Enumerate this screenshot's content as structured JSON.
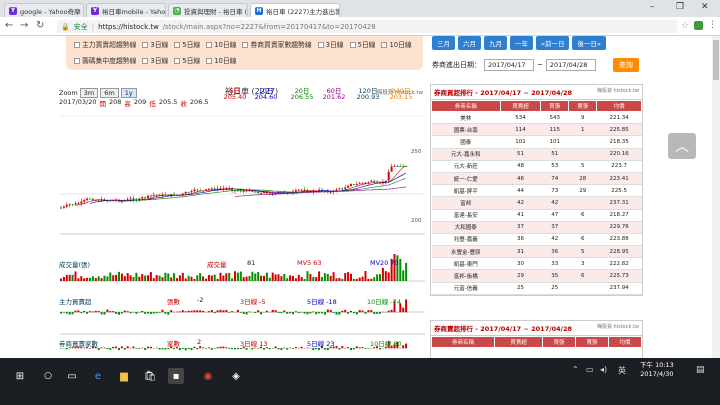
{
  "tabs": [
    {
      "label": "google - Yahoo奇摩 搜尋",
      "icon": "Y",
      "color": "#6e2bd9"
    },
    {
      "label": "裕日車mobile - Yahoo奇摩",
      "icon": "Y",
      "color": "#6e2bd9"
    },
    {
      "label": "投資與理財 - 裕日車 (郭...",
      "icon": "◔",
      "color": "#4caf50"
    },
    {
      "label": "裕日車 (2227)主力進出籌...",
      "icon": "H",
      "color": "#1e6fd9"
    }
  ],
  "address": {
    "secure": "安全",
    "host": "https://histock.tw",
    "path": "/stock/main.aspx?no=2227&from=20170417&to=20170428"
  },
  "filters": {
    "row1": [
      "主力買賣超趨勢線",
      "3日線",
      "5日線",
      "10日線",
      "券商買賣家數趨勢線",
      "3日線",
      "5日線",
      "10日線"
    ],
    "row2": [
      "籌碼集中度趨勢線",
      "3日線",
      "5日線",
      "10日線"
    ]
  },
  "chart": {
    "zoom_label": "Zoom",
    "zoom_buttons": [
      "3m",
      "6m",
      "1y"
    ],
    "title": "裕日車 (2227)",
    "source": "嗨投資 histock.tw",
    "date": "2017/03/20",
    "open_label": "開",
    "open": "208",
    "high_label": "高",
    "high": "209",
    "low_label": "低",
    "low": "205.5",
    "close_label": "收",
    "close": "206.5",
    "ma_labels": [
      "5日",
      "10日",
      "20日",
      "60日",
      "120日",
      "240日"
    ],
    "ma_values": [
      "205.40",
      "204.60",
      "206.55",
      "201.62",
      "200.93",
      "203.15"
    ],
    "y_ticks": [
      "250",
      "200"
    ],
    "volume": {
      "name": "成交量(張)",
      "label": "成交量",
      "value": "81",
      "mv5": "MV5 63",
      "mv20": "MV20 70"
    },
    "main_force": {
      "name": "主力買賣超",
      "label": "張數",
      "value": "-2",
      "d3": "3日線 -5",
      "d5": "5日線 -18",
      "d10": "10日線 -74"
    },
    "broker": {
      "name": "券商買賣家數",
      "label": "家數",
      "value": "2",
      "d3": "3日線 13",
      "d5": "5日線 23",
      "d10": "10日線 60"
    }
  },
  "right": {
    "buttons": [
      "三月",
      "六月",
      "九月",
      "一年",
      "«前一日",
      "後一日»"
    ],
    "query_label": "券商進出日期：",
    "from_date": "2017/04/17",
    "to_sep": "~",
    "to_date": "2017/04/28",
    "query_button": "查詢",
    "table_title": "券商買超排行 - 2017/04/17 ~ 2017/04/28",
    "table_source": "嗨投資 histock.tw",
    "headers": [
      "券商名稱",
      "買賣超",
      "買張",
      "賣張",
      "均價"
    ],
    "rows": [
      [
        "美林",
        "534",
        "543",
        "9",
        "221.34"
      ],
      [
        "國票-台南",
        "114",
        "115",
        "1",
        "225.85"
      ],
      [
        "國泰",
        "101",
        "101",
        "",
        "218.35"
      ],
      [
        "元大-嘉永和",
        "51",
        "51",
        "",
        "220.16"
      ],
      [
        "元大-新莊",
        "48",
        "53",
        "5",
        "223.7"
      ],
      [
        "統一-仁愛",
        "46",
        "74",
        "28",
        "223.41"
      ],
      [
        "凱基-屏平",
        "44",
        "73",
        "29",
        "225.5"
      ],
      [
        "富邦",
        "42",
        "42",
        "",
        "237.31"
      ],
      [
        "富達-長安",
        "41",
        "47",
        "6",
        "218.27"
      ],
      [
        "大和國泰",
        "37",
        "37",
        "",
        "229.76"
      ],
      [
        "兆豐-嘉義",
        "36",
        "42",
        "6",
        "223.88"
      ],
      [
        "永豐金-豐原",
        "31",
        "36",
        "5",
        "228.95"
      ],
      [
        "凱基-東門",
        "30",
        "33",
        "3",
        "222.82"
      ],
      [
        "富邦-板橋",
        "29",
        "35",
        "6",
        "225.73"
      ],
      [
        "元富-信義",
        "25",
        "25",
        "",
        "237.94"
      ]
    ],
    "table2_title": "券商賣超排行 - 2017/04/17 ~ 2017/04/28",
    "table2_source": "嗨投資 histock.tw"
  },
  "taskbar": {
    "time": "下午 10:13",
    "date": "2017/4/30",
    "ime": "英"
  }
}
